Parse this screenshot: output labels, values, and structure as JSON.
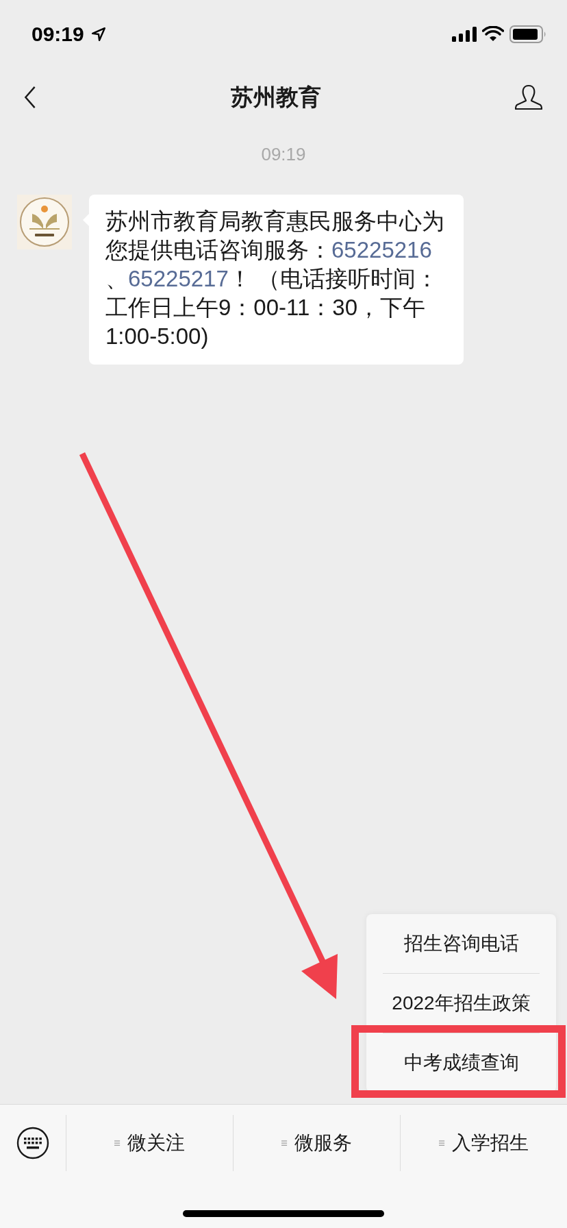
{
  "status_bar": {
    "time": "09:19"
  },
  "nav": {
    "title": "苏州教育"
  },
  "timestamp": "09:19",
  "message": {
    "lines": [
      [
        {
          "kind": "text",
          "text": "苏州市教育局教育惠民服务中心为"
        }
      ],
      [
        {
          "kind": "text",
          "text": "您提供电话咨询服务："
        },
        {
          "kind": "phone",
          "text": "65225216"
        }
      ],
      [
        {
          "kind": "text",
          "text": "、"
        },
        {
          "kind": "phone",
          "text": "65225217"
        },
        {
          "kind": "text",
          "text": "！ （电话接听时间："
        }
      ],
      [
        {
          "kind": "text",
          "text": "工作日上午9：00-11：30，下午"
        }
      ],
      [
        {
          "kind": "text",
          "text": "1:00-5:00)"
        }
      ]
    ]
  },
  "popup_menu": {
    "items": [
      {
        "label": "招生咨询电话",
        "highlighted": false
      },
      {
        "label": "2022年招生政策",
        "highlighted": false
      },
      {
        "label": "中考成绩查询",
        "highlighted": true
      }
    ]
  },
  "annotation_arrow": true,
  "bottom_menu": {
    "items": [
      {
        "label": "微关注"
      },
      {
        "label": "微服务"
      },
      {
        "label": "入学招生"
      }
    ]
  }
}
